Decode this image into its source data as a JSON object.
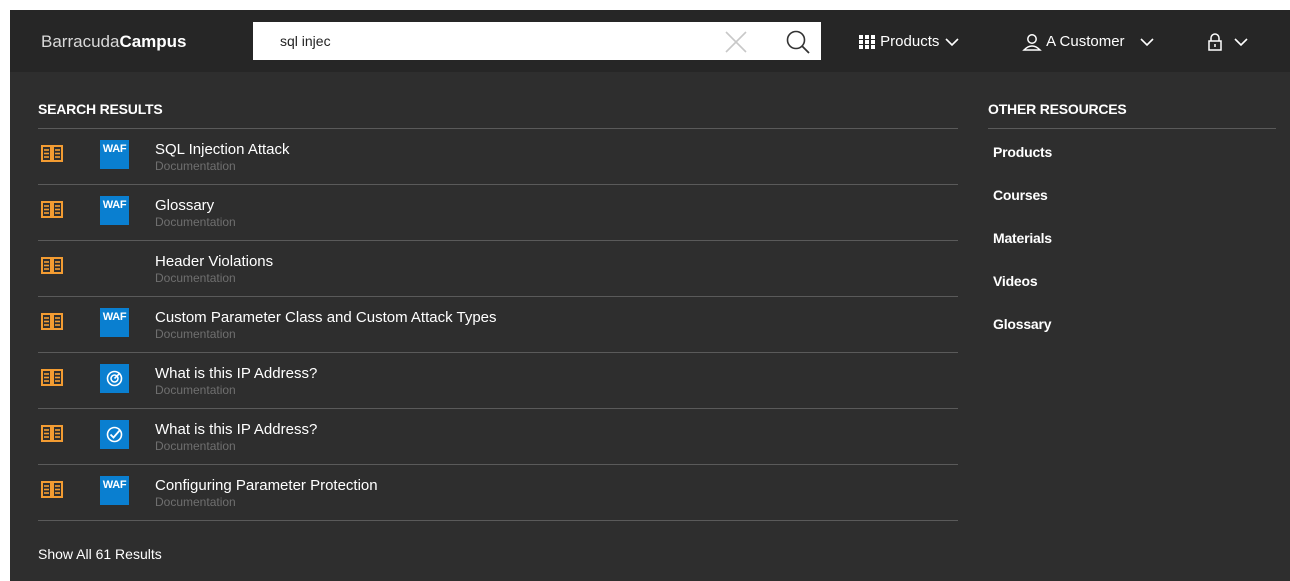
{
  "header": {
    "logo_light": "Barracuda",
    "logo_bold": "Campus",
    "search": {
      "value": "sql injec"
    },
    "nav": {
      "products_label": "Products",
      "account_label": "A Customer"
    }
  },
  "results": {
    "title": "SEARCH RESULTS",
    "items": [
      {
        "title": "SQL Injection Attack",
        "subtitle": "Documentation",
        "badge": "WAF",
        "badge_icon": "waf-badge"
      },
      {
        "title": "Glossary",
        "subtitle": "Documentation",
        "badge": "WAF",
        "badge_icon": "waf-badge"
      },
      {
        "title": "Header Violations",
        "subtitle": "Documentation",
        "badge": "",
        "badge_icon": "none"
      },
      {
        "title": "Custom Parameter Class and Custom Attack Types",
        "subtitle": "Documentation",
        "badge": "WAF",
        "badge_icon": "waf-badge"
      },
      {
        "title": "What is this IP Address?",
        "subtitle": "Documentation",
        "badge": "",
        "badge_icon": "target-icon"
      },
      {
        "title": "What is this IP Address?",
        "subtitle": "Documentation",
        "badge": "",
        "badge_icon": "check-circle-icon"
      },
      {
        "title": "Configuring Parameter Protection",
        "subtitle": "Documentation",
        "badge": "WAF",
        "badge_icon": "waf-badge"
      }
    ],
    "show_all": "Show All 61 Results"
  },
  "resources": {
    "title": "OTHER RESOURCES",
    "links": [
      "Products",
      "Courses",
      "Materials",
      "Videos",
      "Glossary"
    ]
  },
  "colors": {
    "background": "#2e2e2e",
    "header": "#262626",
    "book_icon": "#f39c32",
    "badge": "#0a7fd0",
    "divider": "#5a5a5a",
    "muted_text": "#6f6f6f"
  },
  "icons": {
    "doc": "book-icon",
    "search": "search-icon",
    "clear": "close-icon",
    "grid": "grid-icon",
    "user": "user-icon",
    "lock": "lock-icon",
    "chevron": "chevron-down-icon"
  }
}
